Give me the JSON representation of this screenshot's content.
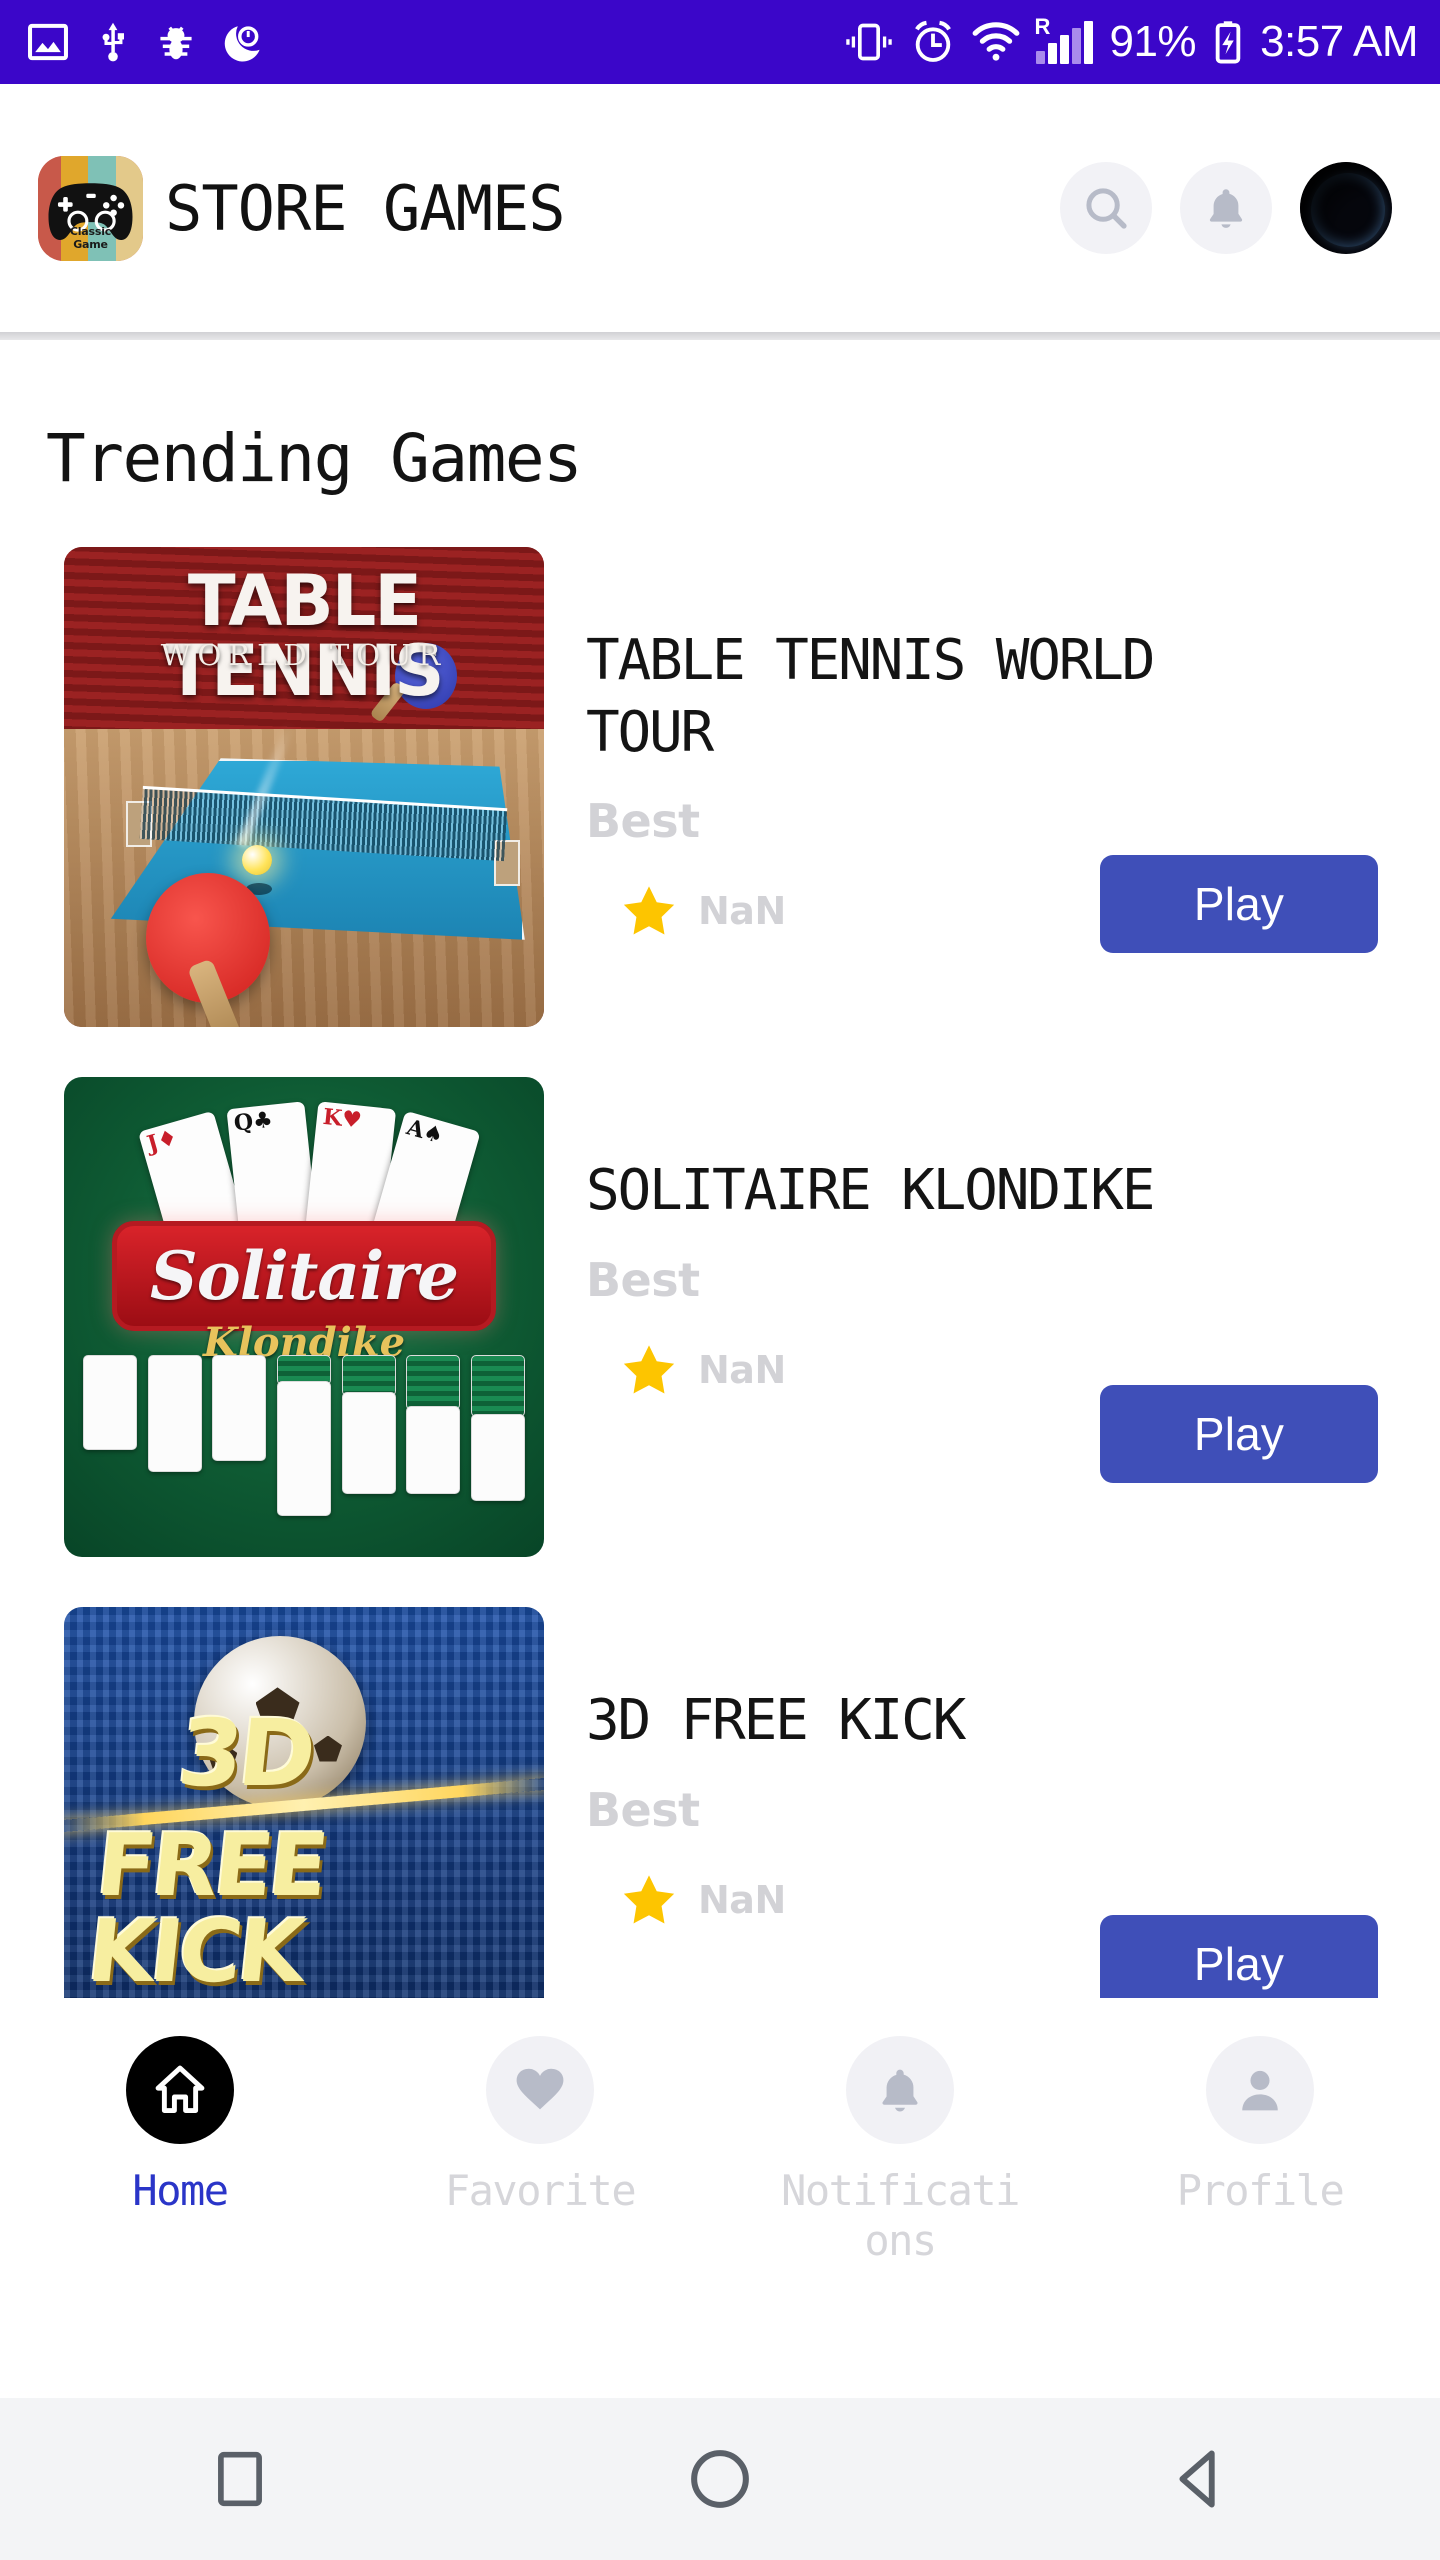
{
  "status_bar": {
    "background": "#3b06c9",
    "left_icons": [
      "image-icon",
      "usb-icon",
      "bug-icon",
      "do-not-disturb-icon"
    ],
    "right_icons": [
      "vibrate-icon",
      "alarm-icon",
      "wifi-icon",
      "signal-icon",
      "battery-charging-icon"
    ],
    "roaming_label": "R",
    "battery_percent": "91%",
    "time": "3:57 AM"
  },
  "header": {
    "logo_name": "classic-game-logo",
    "logo_text_line1": "Classic",
    "logo_text_line2": "Game",
    "logo_stripe_colors": [
      "#c8594a",
      "#e0a72c",
      "#7fc1b6",
      "#e3c98a"
    ],
    "title": "STORE GAMES",
    "actions": [
      {
        "name": "search-button",
        "icon": "search-icon"
      },
      {
        "name": "notifications-button",
        "icon": "bell-icon"
      },
      {
        "name": "avatar",
        "icon": "earth-avatar"
      }
    ]
  },
  "main": {
    "section_title": "Trending Games",
    "accent_color": "#3f4fb8",
    "games": [
      {
        "title": "TABLE TENNIS WORLD TOUR",
        "subtitle": "Best",
        "rating": "NaN",
        "play_label": "Play",
        "thumb_name": "table-tennis-world-tour-thumbnail",
        "thumb_title": "TABLE TENNIS",
        "thumb_subtitle": "WORLD TOUR"
      },
      {
        "title": "SOLITAIRE KLONDIKE",
        "subtitle": "Best",
        "rating": "NaN",
        "play_label": "Play",
        "thumb_name": "solitaire-klondike-thumbnail",
        "thumb_title": "Solitaire",
        "thumb_subtitle": "Klondike"
      },
      {
        "title": "3D FREE KICK",
        "subtitle": "Best",
        "rating": "NaN",
        "play_label": "Play",
        "thumb_name": "3d-free-kick-thumbnail",
        "thumb_title": "3D",
        "thumb_subtitle": "FREE KICK"
      }
    ]
  },
  "bottom_nav": {
    "active_color": "#2a35c8",
    "items": [
      {
        "label": "Home",
        "icon": "home-icon",
        "active": true
      },
      {
        "label": "Favorite",
        "icon": "heart-icon",
        "active": false
      },
      {
        "label": "Notifications",
        "icon": "bell-icon",
        "active": false
      },
      {
        "label": "Profile",
        "icon": "person-icon",
        "active": false
      }
    ]
  },
  "system_nav": {
    "buttons": [
      {
        "name": "recents-button",
        "icon": "square-icon"
      },
      {
        "name": "home-button",
        "icon": "circle-icon"
      },
      {
        "name": "back-button",
        "icon": "triangle-left-icon"
      }
    ]
  }
}
